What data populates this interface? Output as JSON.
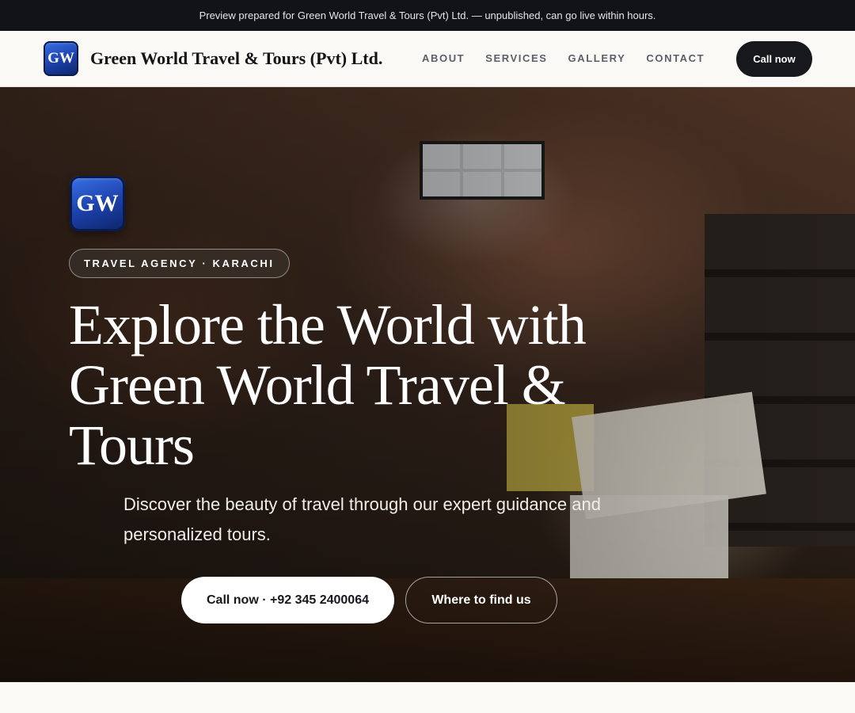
{
  "preview_bar": {
    "text": "Preview prepared for Green World Travel & Tours (Pvt) Ltd. — unpublished, can go live within hours."
  },
  "header": {
    "logo_text": "GW",
    "brand_name": "Green World Travel & Tours (Pvt) Ltd.",
    "nav": [
      "ABOUT",
      "SERVICES",
      "GALLERY",
      "CONTACT"
    ],
    "call_label": "Call now"
  },
  "hero": {
    "logo_text": "GW",
    "badge": "TRAVEL AGENCY · KARACHI",
    "title": "Explore the World with Green World Travel & Tours",
    "subtitle": "Discover the beauty of travel through our expert guidance and personalized tours.",
    "primary_button": "Call now · +92 345 2400064",
    "secondary_button": "Where to find us",
    "background_image": "bookshop-interior-photo"
  },
  "colors": {
    "brand_blue": "#1b3fa8",
    "dark": "#16181c",
    "page_bg": "#faf9f6",
    "nav_text": "#5b6068"
  }
}
